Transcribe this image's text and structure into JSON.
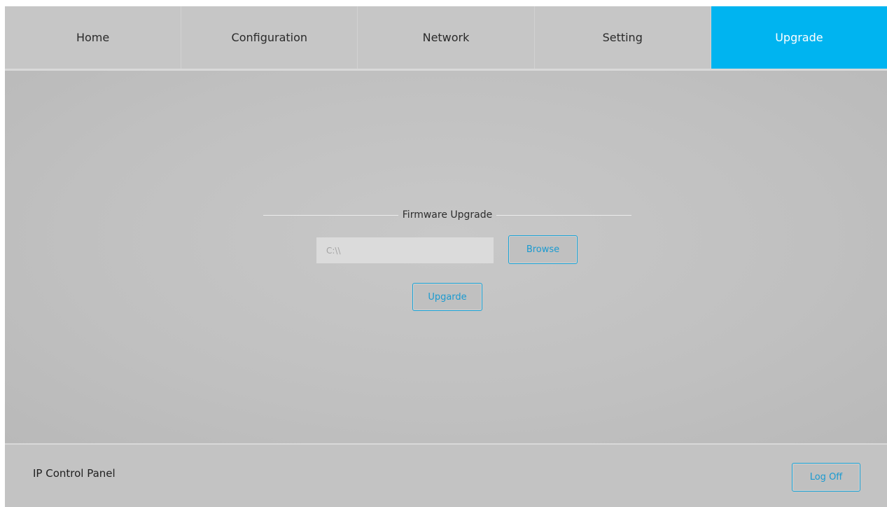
{
  "nav": {
    "tabs": [
      {
        "label": "Home",
        "active": false
      },
      {
        "label": "Configuration",
        "active": false
      },
      {
        "label": "Network",
        "active": false
      },
      {
        "label": "Setting",
        "active": false
      },
      {
        "label": "Upgrade",
        "active": true
      }
    ],
    "active_color": "#00b4f0"
  },
  "firmware": {
    "title": "Firmware Upgrade",
    "file_path_placeholder": "C:\\\\",
    "browse_label": "Browse",
    "upgrade_label": "Upgarde"
  },
  "footer": {
    "title": "IP Control Panel",
    "logoff_label": "Log Off"
  },
  "colors": {
    "background": "#c3c3c3",
    "button_text": "#1a9ad0",
    "button_border": "#1aa3d6"
  }
}
